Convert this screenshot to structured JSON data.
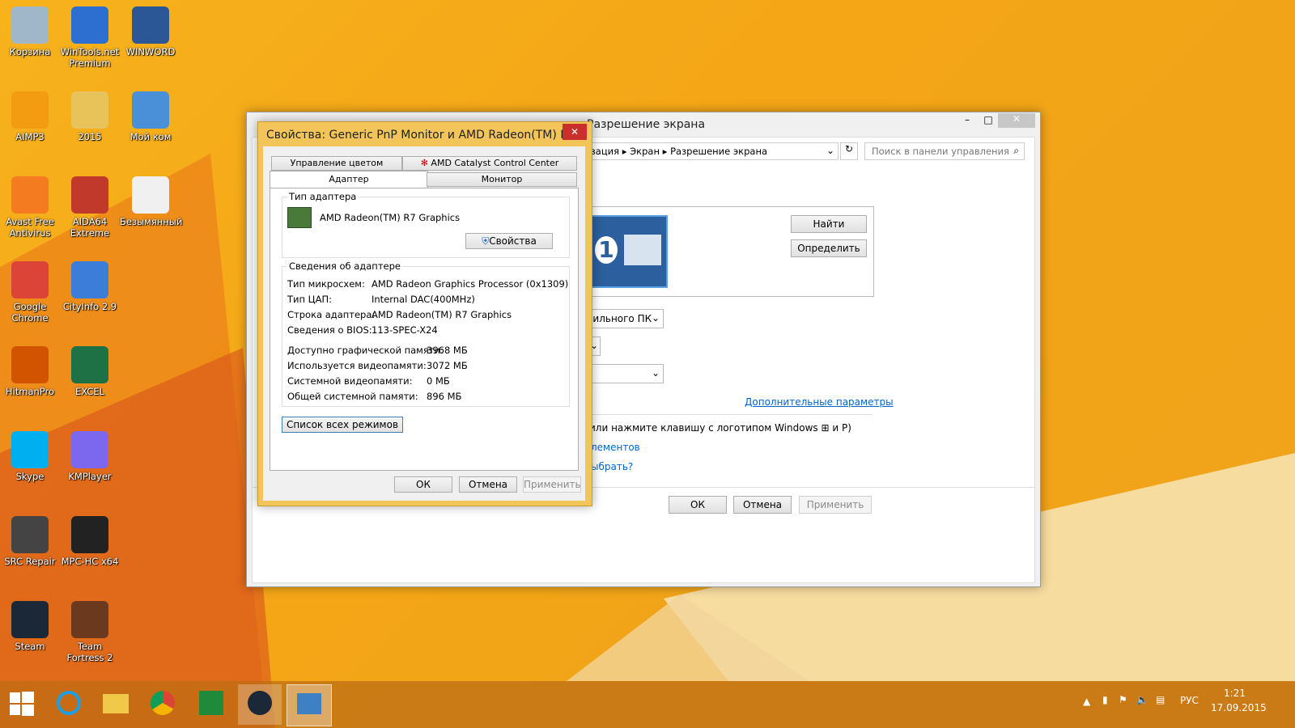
{
  "desktop": {
    "icons": [
      {
        "label": "Корзина",
        "icon": "recycle-bin-icon",
        "color": "#9fb7c8"
      },
      {
        "label": "WinTools.net Premium",
        "icon": "wintools-icon",
        "color": "#2d6fd1"
      },
      {
        "label": "WINWORD",
        "icon": "word-icon",
        "color": "#2b5797"
      },
      {
        "label": "AIMP3",
        "icon": "aimp-icon",
        "color": "#f39c12"
      },
      {
        "label": "2015",
        "icon": "folder-icon",
        "color": "#e8c35a"
      },
      {
        "label": "Мой ком",
        "icon": "computer-icon",
        "color": "#4a90d9"
      },
      {
        "label": "Avast Free Antivirus",
        "icon": "avast-icon",
        "color": "#f47b20"
      },
      {
        "label": "AIDA64 Extreme",
        "icon": "aida64-icon",
        "color": "#c0392b"
      },
      {
        "label": "Безымянный",
        "icon": "image-file-icon",
        "color": "#f0f0f0"
      },
      {
        "label": "Google Chrome",
        "icon": "chrome-icon",
        "color": "#db4437"
      },
      {
        "label": "CityInfo 2.9",
        "icon": "cityinfo-icon",
        "color": "#3b7dd8"
      },
      {
        "label": "HitmanPro",
        "icon": "hitmanpro-icon",
        "color": "#d35400"
      },
      {
        "label": "EXCEL",
        "icon": "excel-icon",
        "color": "#1e7145"
      },
      {
        "label": "Skype",
        "icon": "skype-icon",
        "color": "#00aff0"
      },
      {
        "label": "KMPlayer",
        "icon": "kmplayer-icon",
        "color": "#7b68ee"
      },
      {
        "label": "SRC Repair",
        "icon": "srcrepair-icon",
        "color": "#444"
      },
      {
        "label": "MPC-HC x64",
        "icon": "mpc-icon",
        "color": "#222"
      },
      {
        "label": "Steam",
        "icon": "steam-icon",
        "color": "#1b2838"
      },
      {
        "label": "Team Fortress 2",
        "icon": "tf2-icon",
        "color": "#6b3a1e"
      }
    ]
  },
  "back_window": {
    "title": "Разрешение экрана",
    "breadcrumb": [
      "вация",
      "Экран",
      "Разрешение экрана"
    ],
    "search_placeholder": "Поиск в панели управления",
    "find_button": "Найти",
    "identify_button": "Определить",
    "monitor_number": "1",
    "orientation_partial": "бильного ПК",
    "advanced_link": "Дополнительные параметры",
    "hint_text": "или нажмите клавишу с логотипом Windows",
    "hint_key": "и P)",
    "link_elements": "лементов",
    "link_choose": "ыбрать?",
    "ok": "ОК",
    "cancel": "Отмена",
    "apply": "Применить"
  },
  "dialog": {
    "title": "Свойства: Generic PnP Monitor и AMD Radeon(TM) R...",
    "tabs_top": [
      "Управление цветом",
      "AMD Catalyst Control Center"
    ],
    "tabs_bottom": [
      "Адаптер",
      "Монитор"
    ],
    "adapter_type_group": "Тип адаптера",
    "adapter_name": "AMD Radeon(TM) R7 Graphics",
    "properties_button": "Свойства",
    "info_group": "Сведения об адаптере",
    "info_rows": [
      {
        "k": "Тип микросхем:",
        "v": "AMD Radeon Graphics Processor (0x1309)"
      },
      {
        "k": "Тип ЦАП:",
        "v": "Internal DAC(400MHz)"
      },
      {
        "k": "Строка адаптера:",
        "v": "AMD Radeon(TM) R7 Graphics"
      },
      {
        "k": "Сведения о BIOS:",
        "v": "113-SPEC-X24"
      }
    ],
    "mem_rows": [
      {
        "k": "Доступно графической памяти:",
        "v": "3968 МБ"
      },
      {
        "k": "Используется видеопамяти:",
        "v": "3072 МБ"
      },
      {
        "k": "Системной видеопамяти:",
        "v": "0 МБ"
      },
      {
        "k": "Общей системной памяти:",
        "v": "896 МБ"
      }
    ],
    "list_modes_button": "Список всех режимов",
    "ok": "ОК",
    "cancel": "Отмена",
    "apply": "Применить"
  },
  "taskbar": {
    "items": [
      "start-icon",
      "ie-icon",
      "explorer-icon",
      "chrome-icon",
      "store-icon",
      "steam-icon",
      "control-panel-icon"
    ],
    "lang": "РУС",
    "time": "1:21",
    "date": "17.09.2015"
  }
}
